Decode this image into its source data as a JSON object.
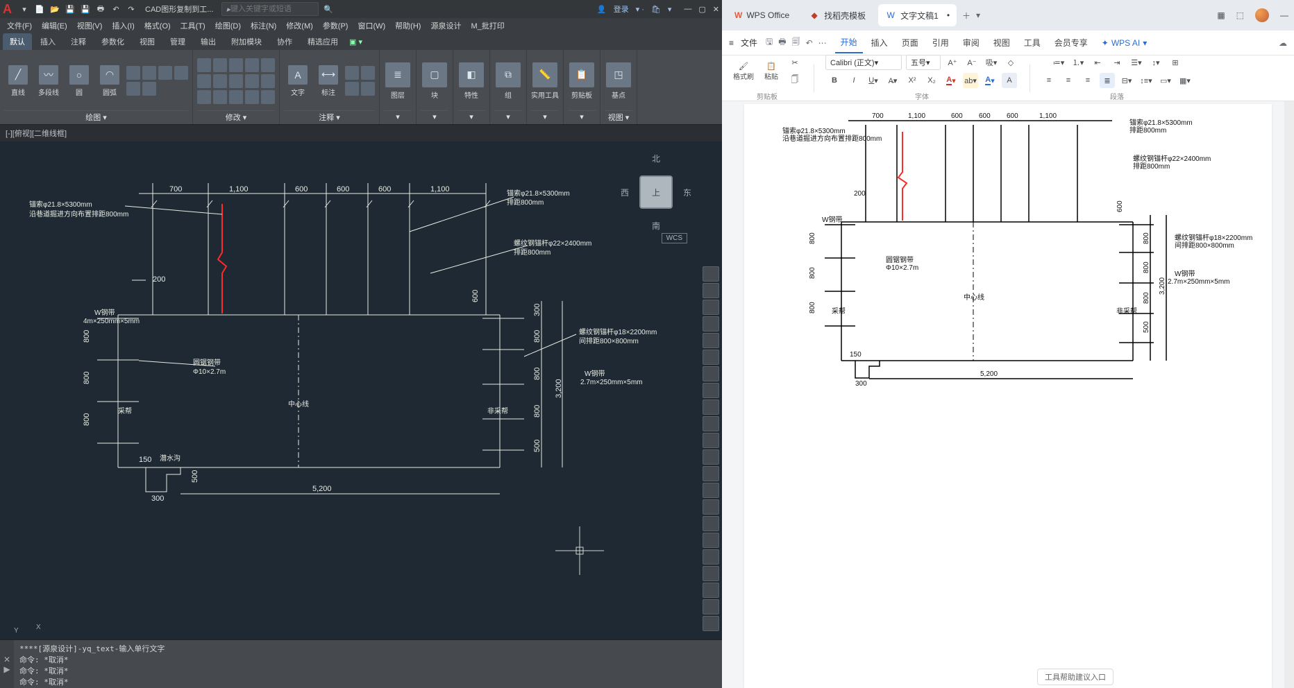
{
  "cad": {
    "title": "CAD图形复制到工...",
    "search_placeholder": "键入关键字或短语",
    "login": "登录",
    "menu": [
      "文件(F)",
      "编辑(E)",
      "视图(V)",
      "插入(I)",
      "格式(O)",
      "工具(T)",
      "绘图(D)",
      "标注(N)",
      "修改(M)",
      "参数(P)",
      "窗口(W)",
      "帮助(H)",
      "源泉设计",
      "M_批打印"
    ],
    "tabs": [
      "默认",
      "插入",
      "注释",
      "参数化",
      "视图",
      "管理",
      "输出",
      "附加模块",
      "协作",
      "精选应用"
    ],
    "active_tab": "默认",
    "panels": {
      "draw": "绘图 ▾",
      "modify": "修改 ▾",
      "annotate": "注释 ▾",
      "layers": "图层",
      "block": "块",
      "properties": "特性",
      "group": "组",
      "utilities": "实用工具",
      "clipboard": "剪贴板",
      "view": "视图 ▾",
      "base": "基点"
    },
    "draw_btns": {
      "line": "直线",
      "polyline": "多段线",
      "circle": "圆",
      "arc": "圆弧"
    },
    "annot_btns": {
      "text": "文字",
      "dim": "标注"
    },
    "viewport_label": "[-][俯视][二维线框]",
    "viewcube": {
      "top": "上",
      "n": "北",
      "s": "南",
      "e": "东",
      "w": "西"
    },
    "wcs": "WCS",
    "ucs": {
      "x": "X",
      "y": "Y"
    },
    "cmd": {
      "l1": "****[源泉设计]-yq_text-输入单行文字",
      "l2": "命令: *取消*",
      "l3": "命令: *取消*",
      "l4": "命令: *取消*"
    },
    "dwg": {
      "top_dims": [
        "700",
        "1,100",
        "600",
        "600",
        "600",
        "1,100"
      ],
      "left_spike": "200",
      "labels": {
        "anchor_cable": "锚索φ21.8×5300mm",
        "anchor_cable_sub": "沿巷道掘进方向布置排距800mm",
        "thread_bolt1": "螺纹钢锚杆φ22×2400mm",
        "thread_bolt1_sub": "排距800mm",
        "thread_bolt2": "螺纹钢锚杆φ18×2200mm",
        "thread_bolt2_sub": "间排距800×800mm",
        "w_belt": "W钢带",
        "w_belt_sub": "4m×250mm×5mm",
        "w_belt2": "W钢带",
        "w_belt2_sub": "2.7m×250mm×5mm",
        "round_steel": "圆锯钢带",
        "round_steel_sub": "Φ10×2.7m",
        "center": "中心线",
        "mining": "采帮",
        "non_mining": "非采帮",
        "water": "潜水沟"
      },
      "left_dims_top": "300",
      "left_col": [
        "800",
        "800",
        "800"
      ],
      "right_col": [
        "800",
        "800",
        "800",
        "500"
      ],
      "right_col_head": "300",
      "right_total": "3,200",
      "right_spike": "600",
      "bottom_span": "5,200",
      "bl_h": "150",
      "bl_v1": "500",
      "bl_w": "300"
    }
  },
  "wps": {
    "tabs": {
      "home": "WPS Office",
      "d2": "找稻壳模板",
      "doc": "文字文稿1"
    },
    "file": "文件",
    "menubar": [
      "开始",
      "插入",
      "页面",
      "引用",
      "审阅",
      "视图",
      "工具",
      "会员专享"
    ],
    "active_menu": "开始",
    "ai": "WPS AI",
    "font": "Calibri (正文)",
    "size": "五号",
    "toolbar": {
      "format_brush": "格式刷",
      "paste": "粘贴"
    },
    "groups": {
      "clipboard": "剪贴板",
      "font": "字体",
      "paragraph": "段落"
    },
    "status": "工具帮助建议入口",
    "dwg": {
      "top_dims": [
        "700",
        "1,100",
        "600",
        "600",
        "600",
        "1,100"
      ],
      "left_spike": "200",
      "labels": {
        "anchor_cable": "锚索φ21.8×5300mm",
        "anchor_cable_sub": "沿巷道掘进方向布置排距800mm",
        "anchor_cable_r": "锚索φ21.8×5300mm",
        "anchor_cable_r_sub": "排距800mm",
        "thread_bolt1": "螺纹钢锚杆φ22×2400mm",
        "thread_bolt1_sub": "排距800mm",
        "thread_bolt2": "螺纹钢锚杆φ18×2200mm",
        "thread_bolt2_sub": "间排距800×800mm",
        "w_belt": "W钢带",
        "w_belt2": "W钢带",
        "w_belt2_sub": "2.7m×250mm×5mm",
        "round_steel": "圆锯钢带",
        "round_steel_sub": "Φ10×2.7m",
        "center": "中心线",
        "mining": "采帮",
        "non_mining": "非采帮"
      },
      "left_col": [
        "800",
        "800",
        "800"
      ],
      "right_col": [
        "800",
        "800",
        "800",
        "500"
      ],
      "right_total": "3,200",
      "right_spike": "600",
      "bottom_span": "5,200",
      "bl_h": "150",
      "bl_w": "300"
    }
  }
}
